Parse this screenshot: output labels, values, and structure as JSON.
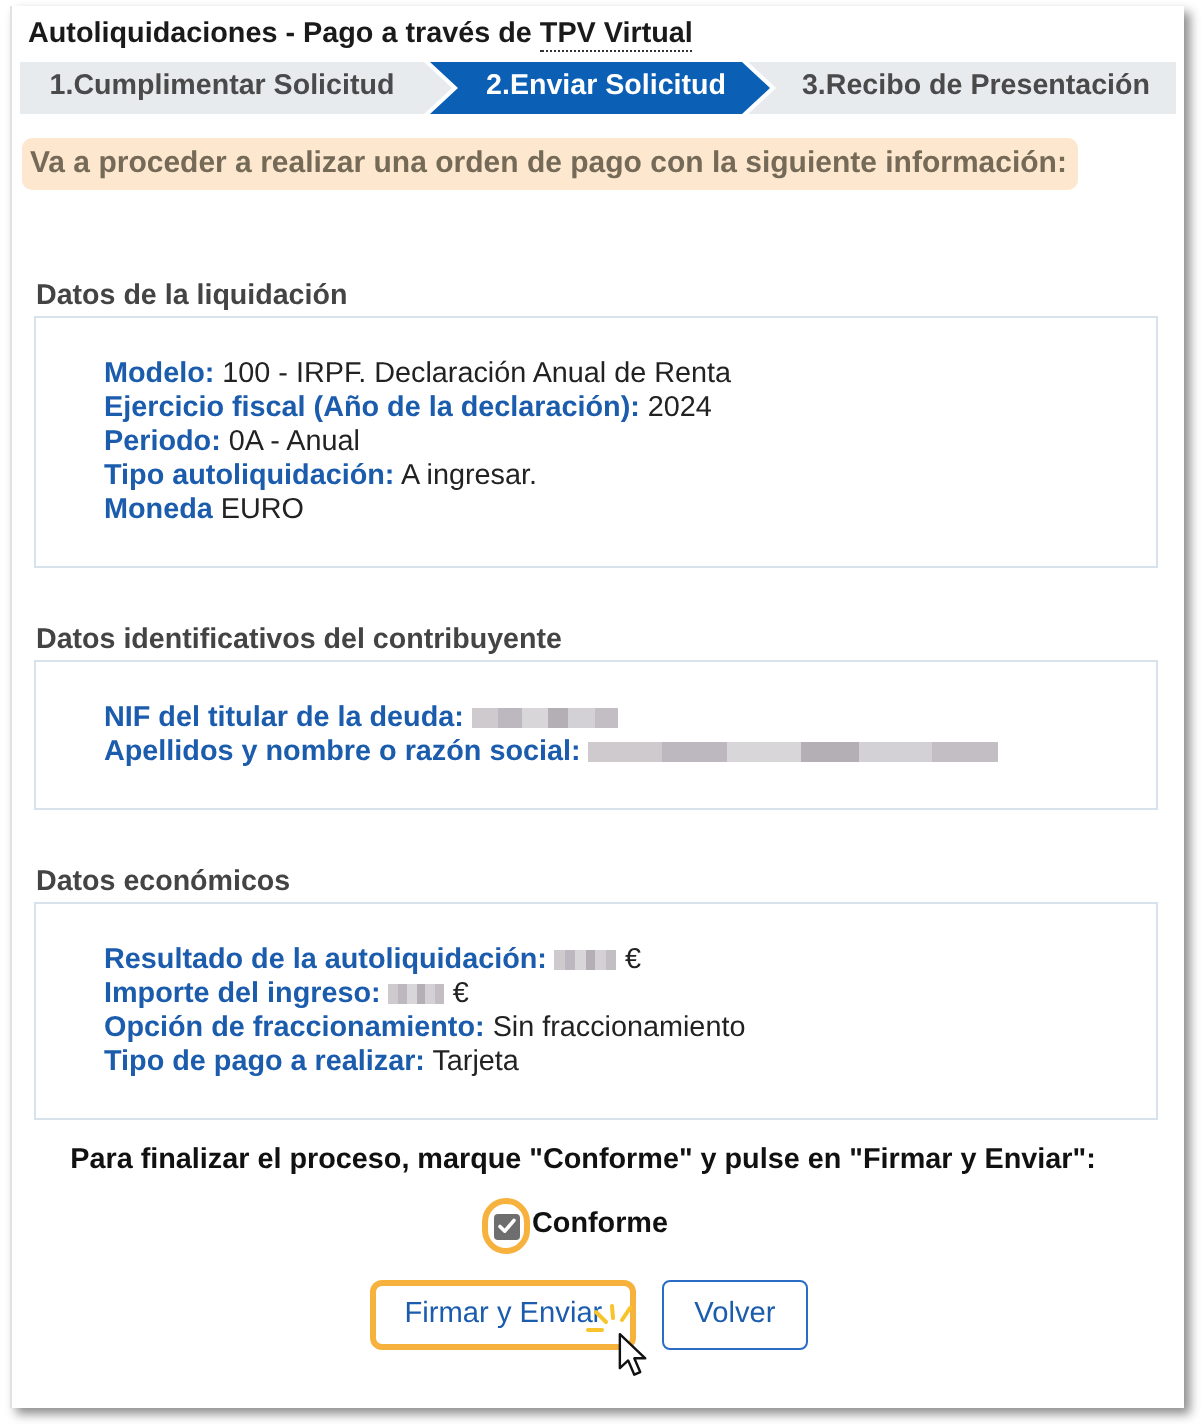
{
  "title": {
    "text": "Autoliquidaciones - Pago a través de",
    "abbreviation": "TPV Virtual"
  },
  "steps": [
    {
      "label": "1.Cumplimentar Solicitud",
      "selected": false
    },
    {
      "label": "2.Enviar Solicitud",
      "selected": true
    },
    {
      "label": "3.Recibo de Presentación",
      "selected": false
    }
  ],
  "notice": "Va a proceder a realizar una orden de pago con la siguiente información:",
  "sections": [
    {
      "heading": "Datos de la liquidación",
      "fields": [
        {
          "label": "Modelo:",
          "value": "100 - IRPF. Declaración Anual de Renta",
          "redacted": false
        },
        {
          "label": "Ejercicio fiscal (Año de la declaración):",
          "value": "2024",
          "redacted": false
        },
        {
          "label": "Periodo:",
          "value": "0A - Anual",
          "redacted": false
        },
        {
          "label": "Tipo autoliquidación:",
          "value": "A ingresar.",
          "redacted": false
        },
        {
          "label": "Moneda",
          "value": "EURO",
          "redacted": false
        }
      ]
    },
    {
      "heading": "Datos identificativos del contribuyente",
      "fields": [
        {
          "label": "NIF del titular de la deuda:",
          "redacted": true
        },
        {
          "label": "Apellidos y nombre o razón social:",
          "redacted": true
        }
      ]
    },
    {
      "heading": "Datos económicos",
      "fields": [
        {
          "label": "Resultado de la autoliquidación:",
          "redacted": true,
          "unit": "€"
        },
        {
          "label": "Importe del ingreso:",
          "redacted": true,
          "unit": "€"
        },
        {
          "label": "Opción de fraccionamiento:",
          "value": "Sin fraccionamiento",
          "redacted": false
        },
        {
          "label": "Tipo de pago a realizar:",
          "value": "Tarjeta",
          "redacted": false
        }
      ]
    }
  ],
  "instruction": "Para finalizar el proceso, marque \"Conforme\" y pulse en \"Firmar y Enviar\":",
  "confirm": {
    "label": "Conforme",
    "checked": true,
    "highlighted": true
  },
  "buttons": [
    {
      "label": "Firmar y Enviar",
      "highlighted": true
    },
    {
      "label": "Volver",
      "highlighted": false
    }
  ]
}
